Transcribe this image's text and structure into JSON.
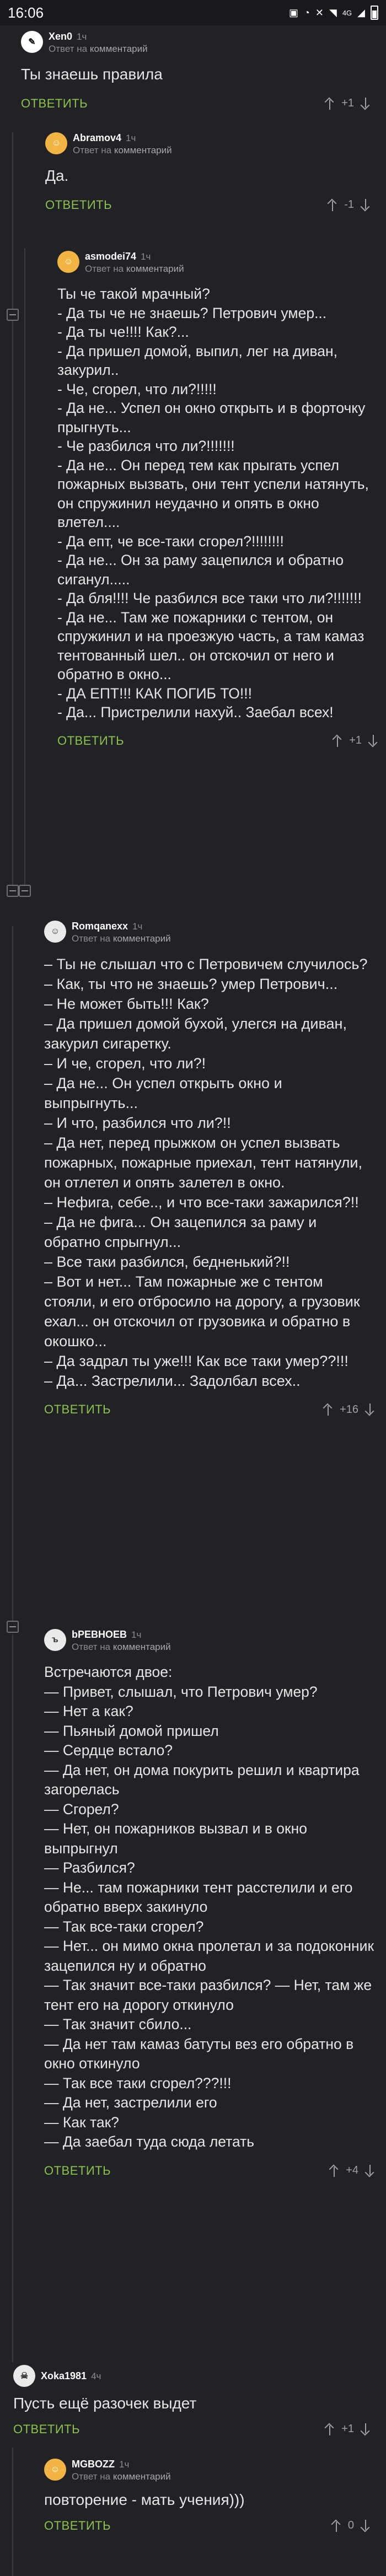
{
  "status": {
    "time": "16:06",
    "signal": "4G"
  },
  "labels": {
    "reply": "ОТВЕТИТЬ",
    "reply_to": "Ответ на",
    "reply_to_target": "комментарий"
  },
  "comments": [
    {
      "user": "Xen0",
      "time": "1ч",
      "text": "Ты знаешь правила",
      "score": "+1"
    },
    {
      "user": "Abramov4",
      "time": "1ч",
      "text": "Да.",
      "score": "-1"
    },
    {
      "user": "asmodei74",
      "time": "1ч",
      "text": "Ты че такой мрачный?\n- Да ты че не знаешь? Петрович умер...\n- Да ты че!!!! Как?...\n- Да пришел домой, выпил, лег на диван, закурил..\n- Че, сгорел, что ли?!!!!!\n- Да не... Успел он окно открыть и в форточку прыгнуть...\n- Че разбился что ли?!!!!!!!\n- Да не... Он перед тем как прыгать успел пожарных вызвать, они тент успели натянуть, он спружинил неудачно и опять в окно влетел....\n- Да епт, че все-таки сгорел?!!!!!!!!\n- Да не... Он за раму зацепился и обратно сиганул.....\n- Да бля!!!! Че разбился все таки что ли?!!!!!!!\n- Да не... Там же пожарники с тентом, он спружинил и на проезжую часть, а там камаз тентованный шел.. он отскочил от него и обратно в окно...\n- ДА ЕПТ!!! КАК ПОГИБ ТО!!!\n- Да... Пристрелили нахуй.. Заебал всех!",
      "score": "+1"
    },
    {
      "user": "Romqanexx",
      "time": "1ч",
      "text": "– Ты не слышал что с Петровичем случилось?\n– Как, ты что не знаешь? умер Петрович...\n– Не может быть!!! Как?\n– Да пришел домой бухой, улегся на диван, закурил сигаретку.\n– И че, сгорел, что ли?!\n– Да не... Он успел открыть окно и выпрыгнуть...\n– И что, разбился что ли?!!\n– Да нет, перед прыжком он успел вызвать пожарных, пожарные приехал, тент натянули, он отлетел и опять залетел в окно.\n– Нефига, себе.., и что все-таки зажарился?!!\n– Да не фига... Он зацепился за раму и обратно спрыгнул...\n– Все таки разбился, бедненький?!!\n– Вот и нет... Там пожарные же с тентом стояли, и его отбросило на дорогу, а грузовик ехал... он отскочил от грузовика и обратно в окошко...\n– Да задрал ты уже!!! Как все таки умер??!!!\n– Да... Застрелили... Задолбал всех..",
      "score": "+16"
    },
    {
      "user": "bPEBHOEB",
      "time": "1ч",
      "text": "Встречаются двое:\n— Привет, слышал, что Петрович умер?\n— Нет а как?\n— Пьяный домой пришел\n— Сердце встало?\n— Да нет, он дома покурить решил и квартира загорелась\n— Сгорел?\n— Нет, он пожарников вызвал и в окно выпрыгнул\n— Разбился?\n— Не... там пожарники тент расстелили и его обратно вверх закинуло\n— Так все-таки сгорел?\n— Нет... он мимо окна пролетал и за подоконник зацепился ну и обратно\n— Так значит все-таки разбился? — Нет, там же тент его на дорогу откинуло\n— Так значит сбило...\n— Да нет там камаз батуты вез его обратно в окно откинуло\n— Так все таки сгорел???!!!\n— Да нет, застрелили его\n— Как так?\n— Да заебал туда сюда летать",
      "score": "+4"
    },
    {
      "user": "Xoka1981",
      "time": "4ч",
      "text": "Пусть ещё разочек выдет",
      "score": "+1"
    },
    {
      "user": "MGBOZZ",
      "time": "1ч",
      "text": "повторение - мать учения)))",
      "score": "0"
    }
  ]
}
